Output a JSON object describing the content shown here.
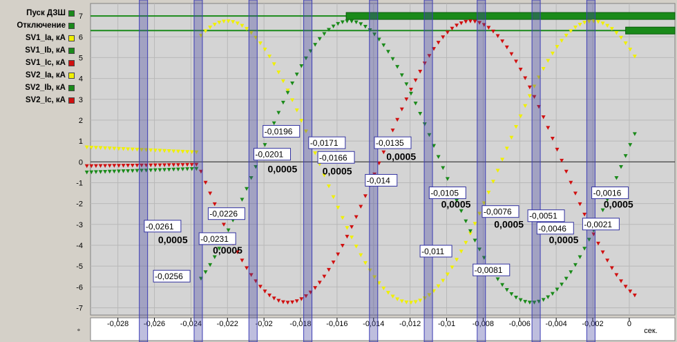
{
  "legend": [
    {
      "label": "Пуск ДЗШ",
      "color": "#1a8a1a"
    },
    {
      "label": "Отключение",
      "color": "#1a8a1a"
    },
    {
      "label": "SV1_Ia, кА",
      "color": "#f0f000"
    },
    {
      "label": "SV1_Ib, кА",
      "color": "#1a8a1a"
    },
    {
      "label": "SV1_Ic, кА",
      "color": "#d01010"
    },
    {
      "label": "SV2_Ia, кА",
      "color": "#f0f000"
    },
    {
      "label": "SV2_Ib, кА",
      "color": "#1a8a1a"
    },
    {
      "label": "SV2_Ic, кА",
      "color": "#d01010"
    }
  ],
  "colors": {
    "phase_a": "#f0f000",
    "phase_b": "#1a8a1a",
    "phase_c": "#d01010",
    "cursor": "#3c3cb4",
    "plot_bg": "#d4d4d4"
  },
  "chart_data": {
    "type": "scatter",
    "xlabel": "сек.",
    "ylabel": "",
    "xlim": [
      -0.0295,
      0.0025
    ],
    "ylim": [
      -7.35,
      7.6
    ],
    "x_ticks": [
      "-0,028",
      "-0,026",
      "-0,024",
      "-0,022",
      "-0,02",
      "-0,018",
      "-0,016",
      "-0,014",
      "-0,012",
      "-0,01",
      "-0,008",
      "-0,006",
      "-0,004",
      "-0,002",
      "0"
    ],
    "x_tick_values": [
      -0.028,
      -0.026,
      -0.024,
      -0.022,
      -0.02,
      -0.018,
      -0.016,
      -0.014,
      -0.012,
      -0.01,
      -0.008,
      -0.006,
      -0.004,
      -0.002,
      0
    ],
    "y_ticks": [
      "7",
      "6",
      "5",
      "4",
      "3",
      "2",
      "1",
      "0",
      "-1",
      "-2",
      "-3",
      "-4",
      "-5",
      "-6",
      "-7"
    ],
    "y_tick_values": [
      7,
      6,
      5,
      4,
      3,
      2,
      1,
      0,
      -1,
      -2,
      -3,
      -4,
      -5,
      -6,
      -7
    ],
    "grid": true,
    "digital_channels": [
      {
        "name": "Пуск ДЗШ",
        "active_from": -0.0155,
        "active_to": 0.0025
      },
      {
        "name": "Отключение",
        "active_from": -0.0002,
        "active_to": 0.0025
      }
    ],
    "series": [
      {
        "name": "Ia",
        "phase": "a",
        "amplitude": 6.75,
        "x_start": -0.0297,
        "x_end": 0.0003,
        "pre_fault": {
          "x_end": -0.0235,
          "value": 0.7
        }
      },
      {
        "name": "Ib",
        "phase": "b",
        "amplitude": 6.75,
        "x_start": -0.0297,
        "x_end": 0.0003,
        "pre_fault": {
          "x_end": -0.0235,
          "value": -0.5
        }
      },
      {
        "name": "Ic",
        "phase": "c",
        "amplitude": 6.75,
        "x_start": -0.0297,
        "x_end": 0.0003,
        "pre_fault": {
          "x_end": -0.0235,
          "value": -0.2
        }
      }
    ],
    "cursors": [
      -0.0266,
      -0.0236,
      -0.0206,
      -0.0176,
      -0.014,
      -0.011,
      -0.0081,
      -0.0051,
      -0.0021
    ],
    "cursor_labels": [
      {
        "text": "-0,0261",
        "x": -0.0261,
        "y": -3.2
      },
      {
        "text": "-0,0256",
        "x": -0.0256,
        "y": -5.6
      },
      {
        "text": "-0,0226",
        "x": -0.0226,
        "y": -2.6
      },
      {
        "text": "-0,0231",
        "x": -0.0231,
        "y": -3.8
      },
      {
        "text": "-0,0196",
        "x": -0.0196,
        "y": 1.35
      },
      {
        "text": "-0,0201",
        "x": -0.0201,
        "y": 0.25
      },
      {
        "text": "-0,0171",
        "x": -0.0171,
        "y": 0.8
      },
      {
        "text": "-0,0166",
        "x": -0.0166,
        "y": 0.1
      },
      {
        "text": "-0,0135",
        "x": -0.0135,
        "y": 0.8
      },
      {
        "text": "-0,014",
        "x": -0.014,
        "y": -1.0
      },
      {
        "text": "-0,0105",
        "x": -0.0105,
        "y": -1.6
      },
      {
        "text": "-0,011",
        "x": -0.011,
        "y": -4.4
      },
      {
        "text": "-0,0076",
        "x": -0.0076,
        "y": -2.5
      },
      {
        "text": "-0,0081",
        "x": -0.0081,
        "y": -5.3
      },
      {
        "text": "-0,0051",
        "x": -0.0051,
        "y": -2.7
      },
      {
        "text": "-0,0046",
        "x": -0.0046,
        "y": -3.3
      },
      {
        "text": "-0,0016",
        "x": -0.0016,
        "y": -1.6
      },
      {
        "text": "-0,0021",
        "x": -0.0021,
        "y": -3.1
      }
    ],
    "delta_labels": [
      {
        "text": "0,0005",
        "x": -0.0258,
        "y": -3.9
      },
      {
        "text": "0,0005",
        "x": -0.0228,
        "y": -4.4
      },
      {
        "text": "0,0005",
        "x": -0.0198,
        "y": -0.5
      },
      {
        "text": "0,0005",
        "x": -0.0168,
        "y": -0.6
      },
      {
        "text": "0,0005",
        "x": -0.0133,
        "y": 0.1
      },
      {
        "text": "0,0005",
        "x": -0.0103,
        "y": -2.2
      },
      {
        "text": "0,0005",
        "x": -0.0074,
        "y": -3.15
      },
      {
        "text": "0,0005",
        "x": -0.0044,
        "y": -3.9
      },
      {
        "text": "0,0005",
        "x": -0.0014,
        "y": -2.2
      }
    ]
  }
}
